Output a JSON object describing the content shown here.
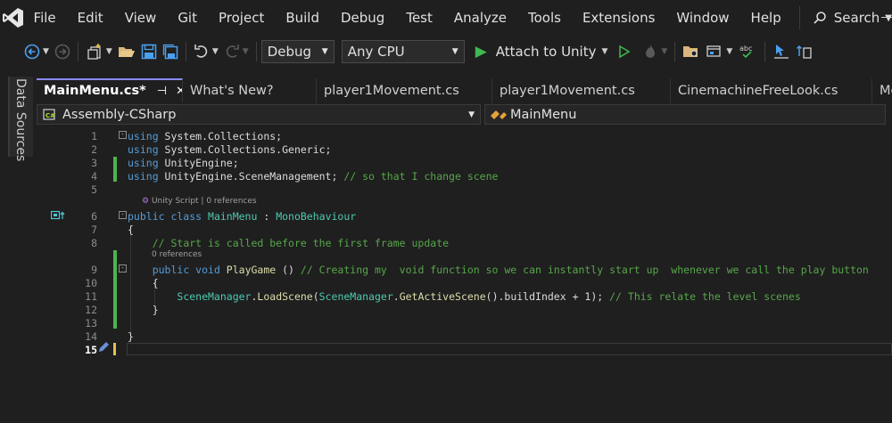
{
  "menu": [
    "File",
    "Edit",
    "View",
    "Git",
    "Project",
    "Build",
    "Debug",
    "Test",
    "Analyze",
    "Tools",
    "Extensions",
    "Window",
    "Help"
  ],
  "search": {
    "label": "Search"
  },
  "toolbar": {
    "config": "Debug",
    "platform": "Any CPU",
    "attach_label": "Attach to Unity"
  },
  "side_panel": {
    "label": "Data Sources"
  },
  "tabs": [
    "MainMenu.cs*",
    "What's New?",
    "player1Movement.cs",
    "player1Movement.cs",
    "CinemachineFreeLook.cs",
    "Me"
  ],
  "nav": {
    "project": "Assembly-CSharp",
    "member": "MainMenu"
  },
  "code_lens": {
    "class": "Unity Script | 0 references",
    "method": "0 references"
  },
  "lines": [
    {
      "n": "1",
      "tokens": [
        {
          "t": "kw",
          "v": "using"
        },
        {
          "t": "pl",
          "v": " System.Collections;"
        }
      ]
    },
    {
      "n": "2",
      "tokens": [
        {
          "t": "kw",
          "v": "using"
        },
        {
          "t": "pl",
          "v": " System.Collections.Generic;"
        }
      ]
    },
    {
      "n": "3",
      "tokens": [
        {
          "t": "kw",
          "v": "using"
        },
        {
          "t": "pl",
          "v": " UnityEngine;"
        }
      ]
    },
    {
      "n": "4",
      "tokens": [
        {
          "t": "kw",
          "v": "using"
        },
        {
          "t": "pl",
          "v": " UnityEngine.SceneManagement; "
        },
        {
          "t": "cm",
          "v": "// so that I change scene"
        }
      ]
    },
    {
      "n": "5",
      "tokens": []
    },
    {
      "n": "6",
      "tokens": [
        {
          "t": "kw",
          "v": "public class "
        },
        {
          "t": "ty",
          "v": "MainMenu"
        },
        {
          "t": "pl",
          "v": " : "
        },
        {
          "t": "ty",
          "v": "MonoBehaviour"
        }
      ]
    },
    {
      "n": "7",
      "tokens": [
        {
          "t": "pl",
          "v": "{"
        }
      ]
    },
    {
      "n": "8",
      "tokens": [
        {
          "t": "pl",
          "v": "    "
        },
        {
          "t": "cm",
          "v": "// Start is called before the first frame update"
        }
      ]
    },
    {
      "n": "9",
      "tokens": [
        {
          "t": "pl",
          "v": "    "
        },
        {
          "t": "kw",
          "v": "public void "
        },
        {
          "t": "fn",
          "v": "PlayGame"
        },
        {
          "t": "pl",
          "v": " () "
        },
        {
          "t": "cm",
          "v": "// Creating my  void function so we can instantly start up  whenever we call the play button"
        }
      ]
    },
    {
      "n": "10",
      "tokens": [
        {
          "t": "pl",
          "v": "    {"
        }
      ]
    },
    {
      "n": "11",
      "tokens": [
        {
          "t": "pl",
          "v": "        "
        },
        {
          "t": "ty",
          "v": "SceneManager"
        },
        {
          "t": "pl",
          "v": "."
        },
        {
          "t": "fn",
          "v": "LoadScene"
        },
        {
          "t": "pl",
          "v": "("
        },
        {
          "t": "ty",
          "v": "SceneManager"
        },
        {
          "t": "pl",
          "v": "."
        },
        {
          "t": "fn",
          "v": "GetActiveScene"
        },
        {
          "t": "pl",
          "v": "().buildIndex + 1); "
        },
        {
          "t": "cm",
          "v": "// This relate the level scenes"
        }
      ]
    },
    {
      "n": "12",
      "tokens": [
        {
          "t": "pl",
          "v": "    }"
        }
      ]
    },
    {
      "n": "13",
      "tokens": []
    },
    {
      "n": "14",
      "tokens": [
        {
          "t": "pl",
          "v": "}"
        }
      ]
    },
    {
      "n": "15",
      "tokens": []
    }
  ]
}
